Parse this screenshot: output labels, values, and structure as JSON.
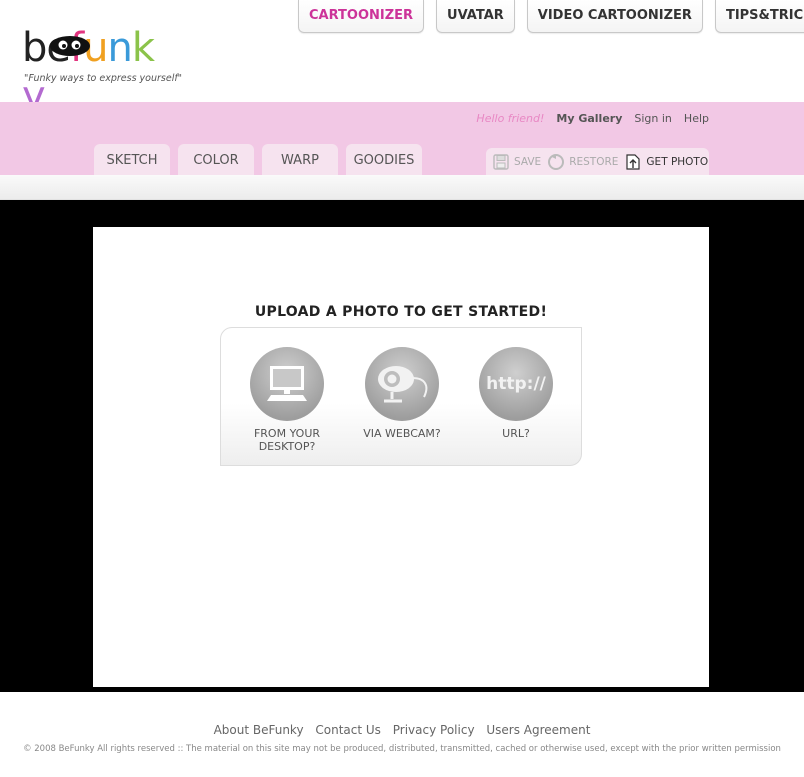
{
  "brand": {
    "logo_text": "befunky",
    "tagline": "\"Funky ways to express yourself\""
  },
  "top_nav": [
    {
      "label": "CARTOONIZER",
      "active": true
    },
    {
      "label": "UVATAR",
      "active": false
    },
    {
      "label": "VIDEO CARTOONIZER",
      "active": false
    },
    {
      "label": "TIPS&TRICKS",
      "active": false
    }
  ],
  "user_bar": {
    "greeting": "Hello friend!",
    "gallery": "My Gallery",
    "signin": "Sign in",
    "help": "Help"
  },
  "tool_tabs": [
    "SKETCH",
    "COLOR",
    "WARP",
    "GOODIES"
  ],
  "photo_actions": {
    "save": "SAVE",
    "restore": "RESTORE",
    "get_photo": "GET PHOTO"
  },
  "upload": {
    "title": "UPLOAD A PHOTO TO GET STARTED!",
    "desktop_line1": "FROM YOUR",
    "desktop_line2": "DESKTOP?",
    "webcam": "VIA WEBCAM?",
    "url_icon": "http://",
    "url": "URL?"
  },
  "footer": {
    "links": [
      "About BeFunky",
      "Contact Us",
      "Privacy Policy",
      "Users Agreement"
    ],
    "copyright": "© 2008 BeFunky All rights reserved :: The material on this site may not be produced, distributed, transmitted, cached or otherwise used, except with the prior written permission"
  },
  "colors": {
    "accent": "#cc3399",
    "pink_band": "#f2c8e5",
    "tab_bg": "#f6e3ef",
    "stage": "#000000"
  }
}
